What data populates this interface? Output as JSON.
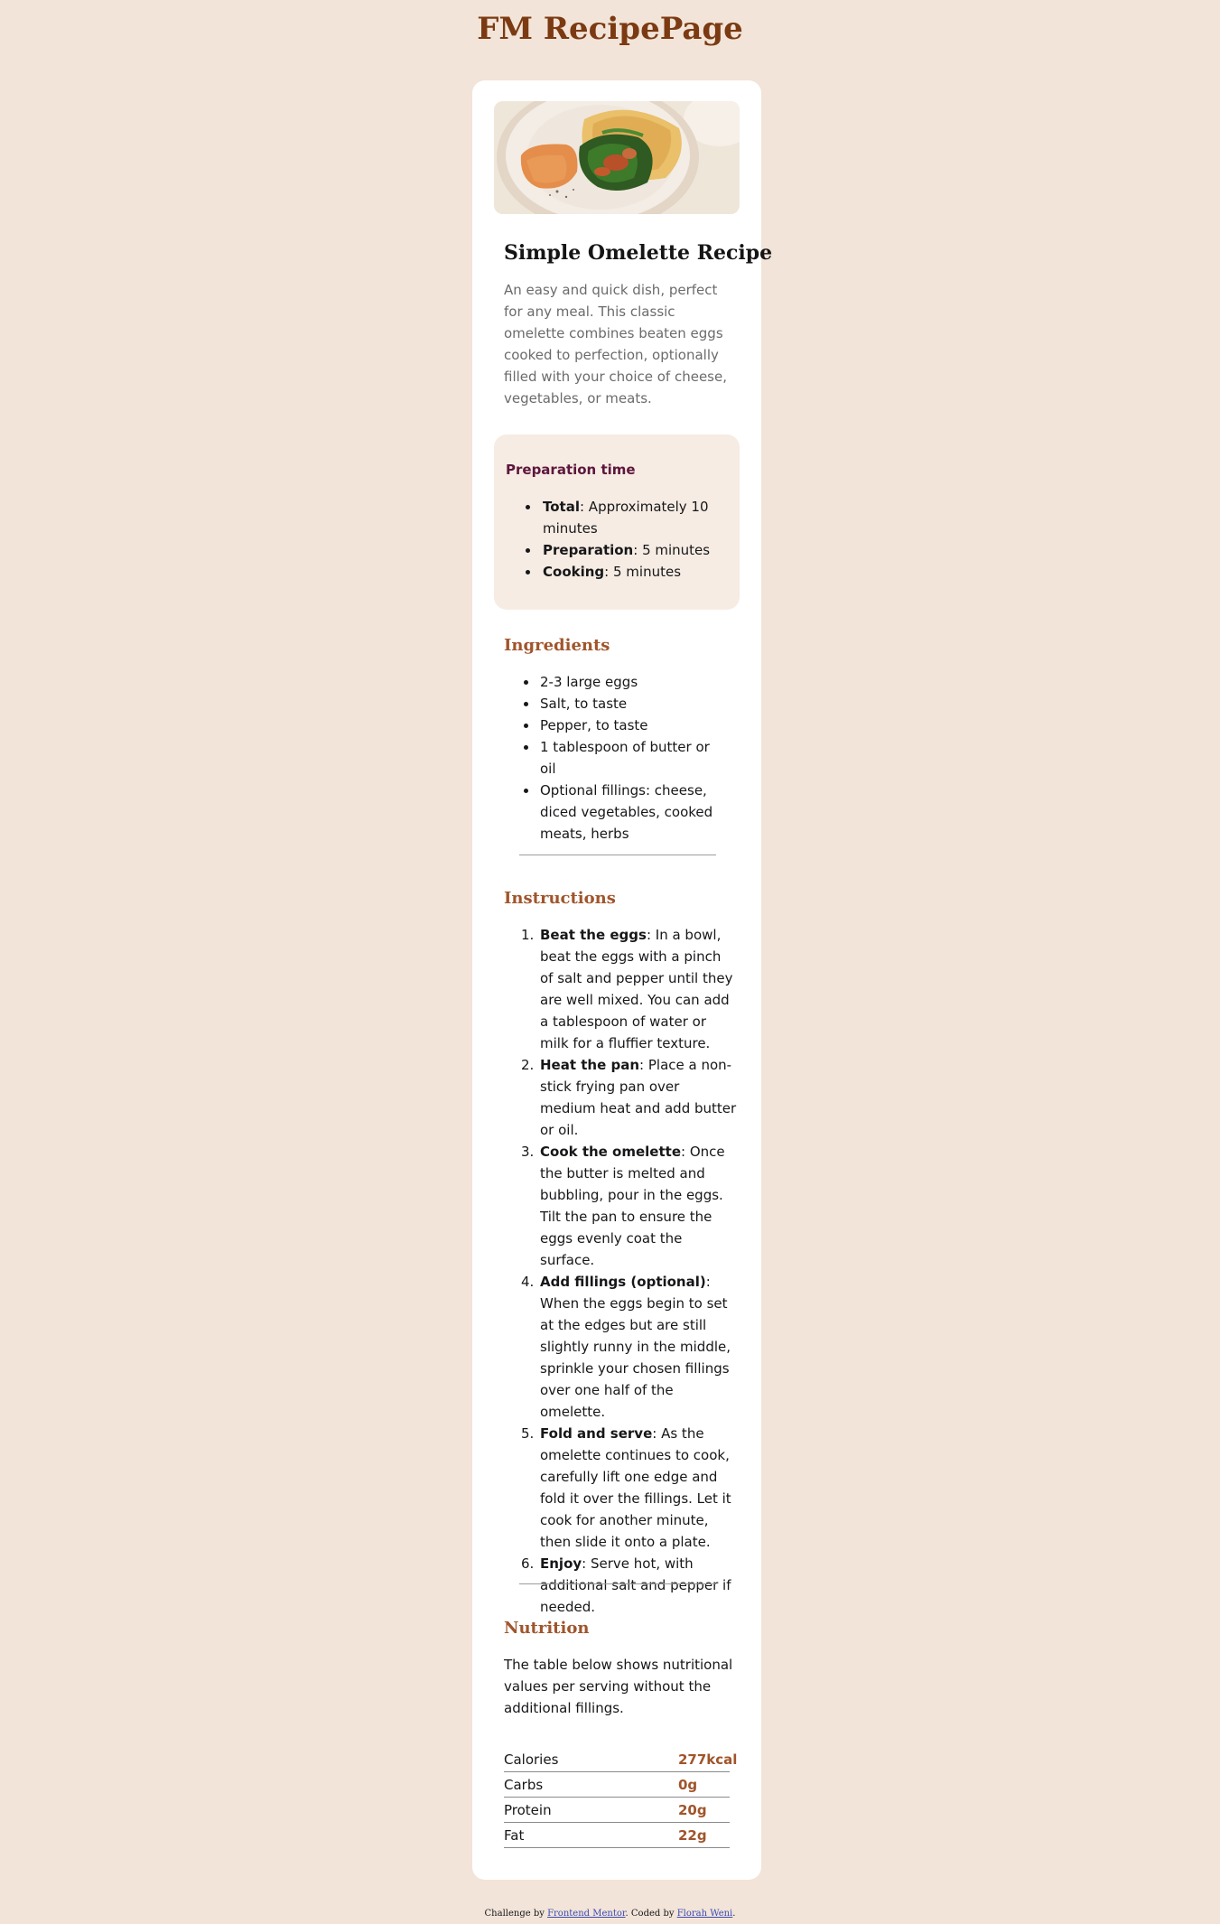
{
  "site": {
    "title": "FM RecipePage"
  },
  "recipe": {
    "title": "Simple Omelette Recipe",
    "description": "An easy and quick dish, perfect for any meal. This classic omelette combines beaten eggs cooked to perfection, optionally filled with your choice of cheese, vegetables, or meats."
  },
  "preparation": {
    "heading": "Preparation time",
    "items": [
      {
        "label": "Total",
        "text": ": Approximately 10 minutes"
      },
      {
        "label": "Preparation",
        "text": ": 5 minutes"
      },
      {
        "label": "Cooking",
        "text": ": 5 minutes"
      }
    ]
  },
  "ingredients": {
    "heading": "Ingredients",
    "items": [
      "2-3 large eggs",
      "Salt, to taste",
      "Pepper, to taste",
      "1 tablespoon of butter or oil",
      "Optional fillings: cheese, diced vegetables, cooked meats, herbs"
    ]
  },
  "instructions": {
    "heading": "Instructions",
    "steps": [
      {
        "num": "1.",
        "label": "Beat the eggs",
        "text": ": In a bowl, beat the eggs with a pinch of salt and pepper until they are well mixed. You can add a tablespoon of water or milk for a fluffier texture."
      },
      {
        "num": "2.",
        "label": "Heat the pan",
        "text": ": Place a non-stick frying pan over medium heat and add butter or oil."
      },
      {
        "num": "3.",
        "label": "Cook the omelette",
        "text": ": Once the butter is melted and bubbling, pour in the eggs. Tilt the pan to ensure the eggs evenly coat the surface."
      },
      {
        "num": "4.",
        "label": "Add fillings (optional)",
        "text": ": When the eggs begin to set at the edges but are still slightly runny in the middle, sprinkle your chosen fillings over one half of the omelette."
      },
      {
        "num": "5.",
        "label": "Fold and serve",
        "text": ": As the omelette continues to cook, carefully lift one edge and fold it over the fillings. Let it cook for another minute, then slide it onto a plate."
      },
      {
        "num": "6.",
        "label": "Enjoy",
        "text": ": Serve hot, with additional salt and pepper if needed."
      }
    ]
  },
  "nutrition": {
    "heading": "Nutrition",
    "description": "The table below shows nutritional values per serving without the additional fillings.",
    "rows": [
      {
        "label": "Calories",
        "value": "277kcal"
      },
      {
        "label": "Carbs",
        "value": "0g"
      },
      {
        "label": "Protein",
        "value": "20g"
      },
      {
        "label": "Fat",
        "value": "22g"
      }
    ]
  },
  "footer": {
    "prefix": "Challenge by ",
    "link1": "Frontend Mentor",
    "middle": ". Coded by ",
    "link2": "Florah Weni",
    "suffix": "."
  },
  "colors": {
    "background": "#f2e4d8",
    "card": "#ffffff",
    "accent_brown": "#a0552b",
    "title_brown": "#7b3a12",
    "prep_title": "#5d163d",
    "prep_box": "#f6ece3"
  }
}
